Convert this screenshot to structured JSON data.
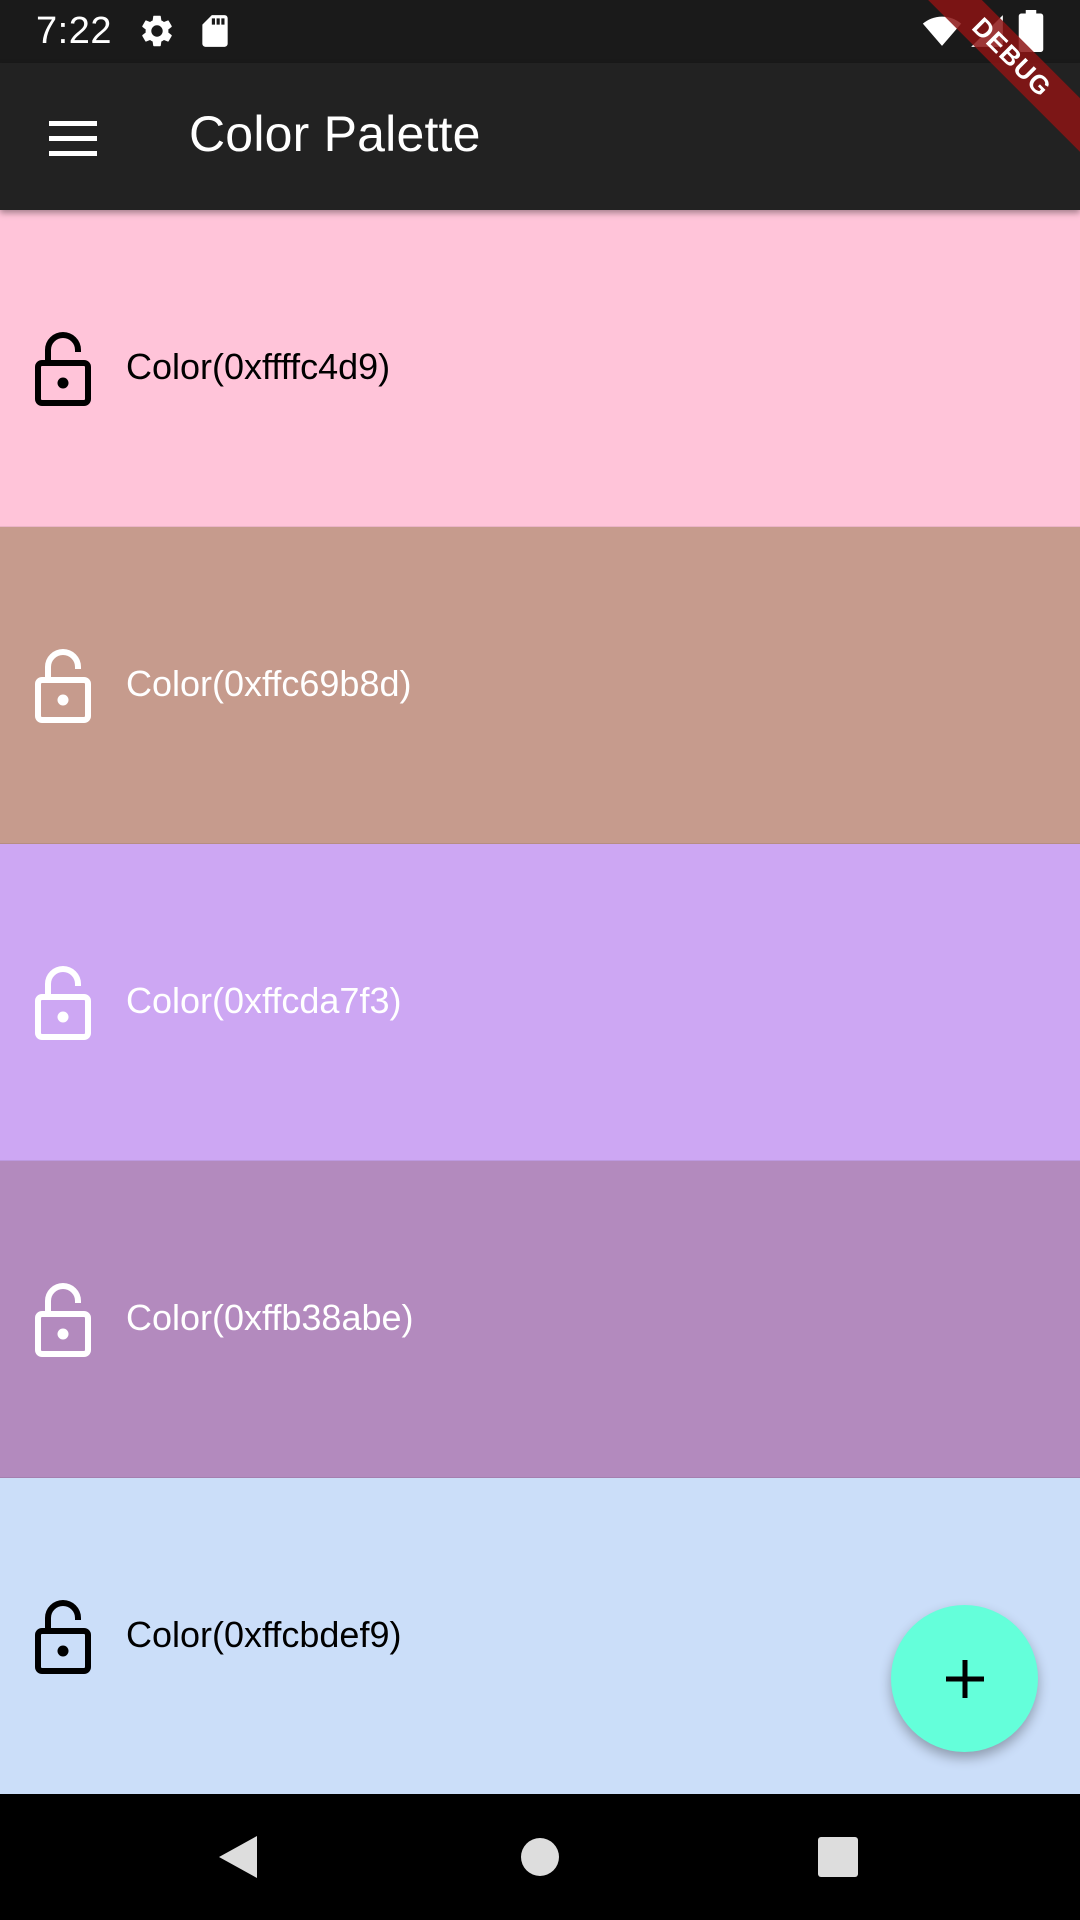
{
  "status_bar": {
    "time": "7:22",
    "icons": [
      "settings-icon",
      "sd-card-icon",
      "wifi-icon",
      "signal-icon",
      "battery-icon"
    ]
  },
  "app_bar": {
    "title": "Color Palette",
    "menu_icon": "hamburger-menu-icon"
  },
  "debug_banner": "DEBUG",
  "colors": [
    {
      "label": "Color(0xffffc4d9)",
      "hex": "#ffc4d9",
      "text_color": "#000000",
      "locked": false
    },
    {
      "label": "Color(0xffc69b8d)",
      "hex": "#c69b8d",
      "text_color": "#ffffff",
      "locked": false
    },
    {
      "label": "Color(0xffcda7f3)",
      "hex": "#cda7f3",
      "text_color": "#ffffff",
      "locked": false
    },
    {
      "label": "Color(0xffb38abe)",
      "hex": "#b38abe",
      "text_color": "#ffffff",
      "locked": false
    },
    {
      "label": "Color(0xffcbdef9)",
      "hex": "#cbdef9",
      "text_color": "#000000",
      "locked": false
    }
  ],
  "fab": {
    "icon": "plus-icon",
    "color": "#64ffda"
  },
  "nav_bar": {
    "icons": [
      "back-icon",
      "home-icon",
      "recents-icon"
    ]
  }
}
